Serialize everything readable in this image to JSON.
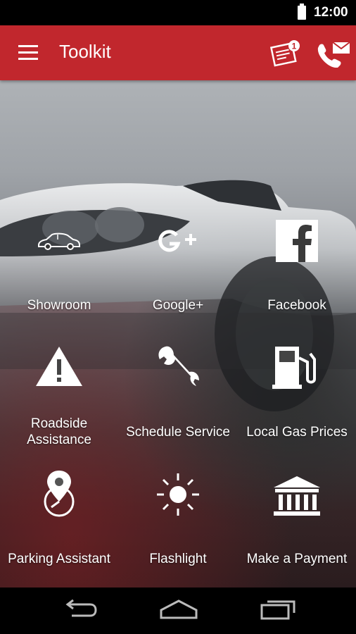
{
  "status_bar": {
    "time": "12:00"
  },
  "app_bar": {
    "title": "Toolkit",
    "notification_count": "1"
  },
  "tiles": [
    {
      "label": "Showroom"
    },
    {
      "label": "Google+"
    },
    {
      "label": "Facebook"
    },
    {
      "label": "Roadside\nAssistance"
    },
    {
      "label": "Schedule Service"
    },
    {
      "label": "Local Gas Prices"
    },
    {
      "label": "Parking Assistant"
    },
    {
      "label": "Flashlight"
    },
    {
      "label": "Make a Payment"
    }
  ],
  "icons": {
    "menu": "menu-icon",
    "notes": "notes-icon",
    "contact": "phone-mail-icon",
    "showroom": "car-icon",
    "google": "google-plus-icon",
    "facebook": "facebook-icon",
    "roadside": "warning-icon",
    "service": "wrench-icon",
    "gas": "gas-pump-icon",
    "parking": "map-pin-clock-icon",
    "flashlight": "sun-icon",
    "payment": "bank-icon"
  },
  "colors": {
    "app_bar": "#c1272d",
    "text": "#ffffff"
  }
}
